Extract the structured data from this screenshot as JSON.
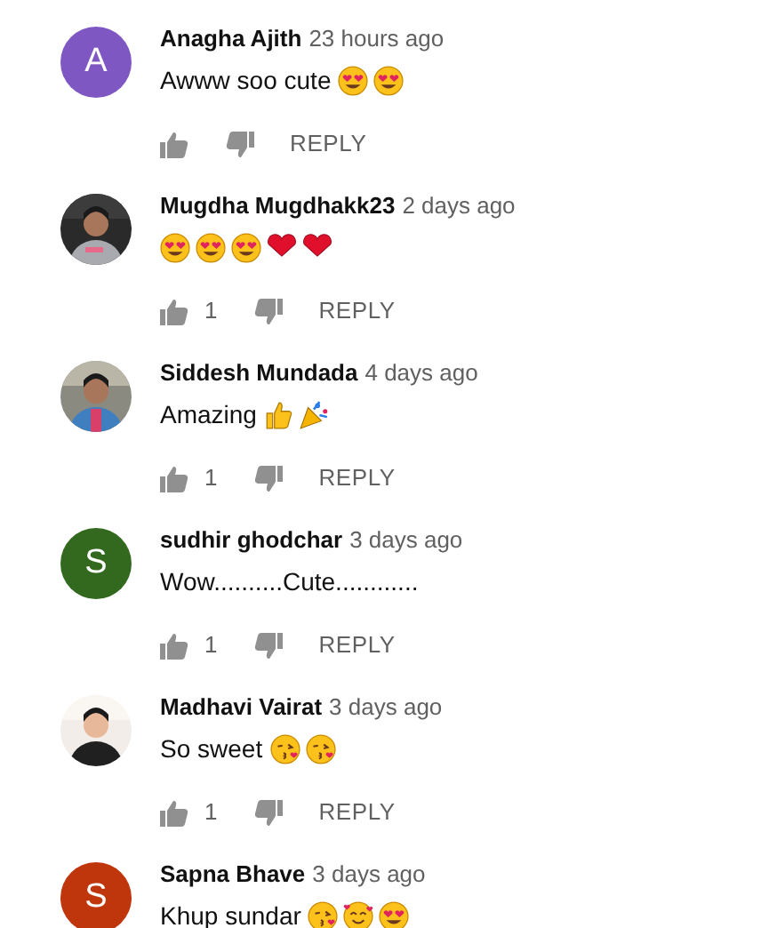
{
  "comments": [
    {
      "author": "Anagha Ajith",
      "time": "23 hours ago",
      "text": "Awww soo cute",
      "emojis": [
        {
          "kind": "heart-eyes"
        },
        {
          "kind": "heart-eyes"
        }
      ],
      "avatar": {
        "kind": "letter",
        "letter": "A",
        "color": "#7e57c2"
      },
      "actions": {
        "reply": "REPLY"
      }
    },
    {
      "author": "Mugdha Mugdhakk23",
      "time": "2 days ago",
      "emojis": [
        {
          "kind": "heart-eyes"
        },
        {
          "kind": "heart-eyes"
        },
        {
          "kind": "heart-eyes"
        },
        {
          "kind": "heart"
        },
        {
          "kind": "heart"
        }
      ],
      "avatar": {
        "kind": "picture"
      },
      "actions": {
        "likes": "1",
        "reply": "REPLY"
      }
    },
    {
      "author": "Siddesh Mundada",
      "time": "4 days ago",
      "text": "Amazing",
      "emojis": [
        {
          "kind": "thumbs-up"
        },
        {
          "kind": "party-popper"
        }
      ],
      "avatar": {
        "kind": "picture"
      },
      "actions": {
        "likes": "1",
        "reply": "REPLY"
      }
    },
    {
      "author": "sudhir ghodchar",
      "time": "3 days ago",
      "text": "Wow..........Cute............",
      "avatar": {
        "kind": "letter",
        "letter": "S",
        "color": "#33691e"
      },
      "actions": {
        "likes": "1",
        "reply": "REPLY"
      }
    },
    {
      "author": "Madhavi Vairat",
      "time": "3 days ago",
      "text": "So sweet",
      "emojis": [
        {
          "kind": "kiss"
        },
        {
          "kind": "kiss"
        }
      ],
      "avatar": {
        "kind": "picture"
      },
      "actions": {
        "likes": "1",
        "reply": "REPLY"
      }
    },
    {
      "author": "Sapna Bhave",
      "time": "3 days ago",
      "text": "Khup sundar",
      "emojis": [
        {
          "kind": "kiss"
        },
        {
          "kind": "smiling-hearts"
        },
        {
          "kind": "heart-eyes"
        }
      ],
      "avatar": {
        "kind": "letter",
        "letter": "S",
        "color": "#bf360c"
      }
    }
  ]
}
